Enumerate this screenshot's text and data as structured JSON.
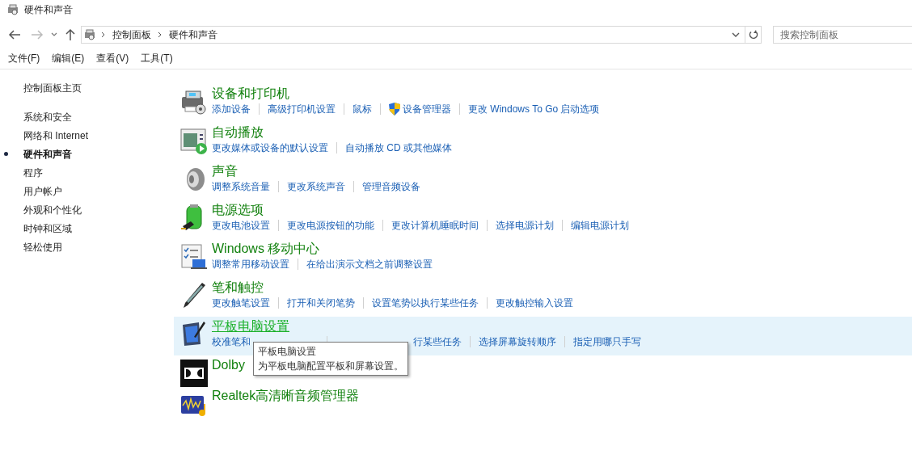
{
  "window": {
    "title": "硬件和声音"
  },
  "address_bar": {
    "path": [
      {
        "label": "控制面板"
      },
      {
        "label": "硬件和声音"
      }
    ]
  },
  "search": {
    "placeholder": "搜索控制面板"
  },
  "menu": [
    "文件(F)",
    "编辑(E)",
    "查看(V)",
    "工具(T)"
  ],
  "sidebar": {
    "home": "控制面板主页",
    "items": [
      {
        "label": "系统和安全",
        "selected": false
      },
      {
        "label": "网络和 Internet",
        "selected": false
      },
      {
        "label": "硬件和声音",
        "selected": true
      },
      {
        "label": "程序",
        "selected": false
      },
      {
        "label": "用户帐户",
        "selected": false
      },
      {
        "label": "外观和个性化",
        "selected": false
      },
      {
        "label": "时钟和区域",
        "selected": false
      },
      {
        "label": "轻松使用",
        "selected": false
      }
    ]
  },
  "categories": [
    {
      "kind": "printer",
      "title": "设备和打印机",
      "hovered": false,
      "links": [
        {
          "label": "添加设备",
          "shield": false
        },
        {
          "label": "高级打印机设置",
          "shield": false
        },
        {
          "label": "鼠标",
          "shield": false
        },
        {
          "label": "设备管理器",
          "shield": true
        },
        {
          "label": "更改 Windows To Go 启动选项",
          "shield": false
        }
      ]
    },
    {
      "kind": "autoplay",
      "title": "自动播放",
      "hovered": false,
      "links": [
        {
          "label": "更改媒体或设备的默认设置",
          "shield": false
        },
        {
          "label": "自动播放 CD 或其他媒体",
          "shield": false
        }
      ]
    },
    {
      "kind": "speaker",
      "title": "声音",
      "hovered": false,
      "links": [
        {
          "label": "调整系统音量",
          "shield": false
        },
        {
          "label": "更改系统声音",
          "shield": false
        },
        {
          "label": "管理音频设备",
          "shield": false
        }
      ]
    },
    {
      "kind": "battery",
      "title": "电源选项",
      "hovered": false,
      "links": [
        {
          "label": "更改电池设置",
          "shield": false
        },
        {
          "label": "更改电源按钮的功能",
          "shield": false
        },
        {
          "label": "更改计算机睡眠时间",
          "shield": false
        },
        {
          "label": "选择电源计划",
          "shield": false
        },
        {
          "label": "编辑电源计划",
          "shield": false
        }
      ]
    },
    {
      "kind": "mobility",
      "title": "Windows 移动中心",
      "hovered": false,
      "links": [
        {
          "label": "调整常用移动设置",
          "shield": false
        },
        {
          "label": "在给出演示文档之前调整设置",
          "shield": false
        }
      ]
    },
    {
      "kind": "pen",
      "title": "笔和触控",
      "hovered": false,
      "links": [
        {
          "label": "更改触笔设置",
          "shield": false
        },
        {
          "label": "打开和关闭笔势",
          "shield": false
        },
        {
          "label": "设置笔势以执行某些任务",
          "shield": false
        },
        {
          "label": "更改触控输入设置",
          "shield": false
        }
      ]
    },
    {
      "kind": "tablet",
      "title": "平板电脑设置",
      "hovered": true,
      "links": [
        {
          "kind": "head",
          "label": "校准笔和",
          "shield": false
        },
        {
          "kind": "tail",
          "label": "行某些任务",
          "shield": false
        },
        {
          "kind": "whole",
          "label": "选择屏幕旋转顺序",
          "shield": false
        },
        {
          "kind": "whole",
          "label": "指定用哪只手写",
          "shield": false
        }
      ]
    },
    {
      "kind": "dolby",
      "title": "Dolby",
      "hovered": false
    },
    {
      "kind": "realtek",
      "title": "Realtek高清晰音频管理器",
      "hovered": false
    }
  ],
  "tooltip": {
    "title": "平板电脑设置",
    "text": "为平板电脑配置平板和屏幕设置。"
  }
}
